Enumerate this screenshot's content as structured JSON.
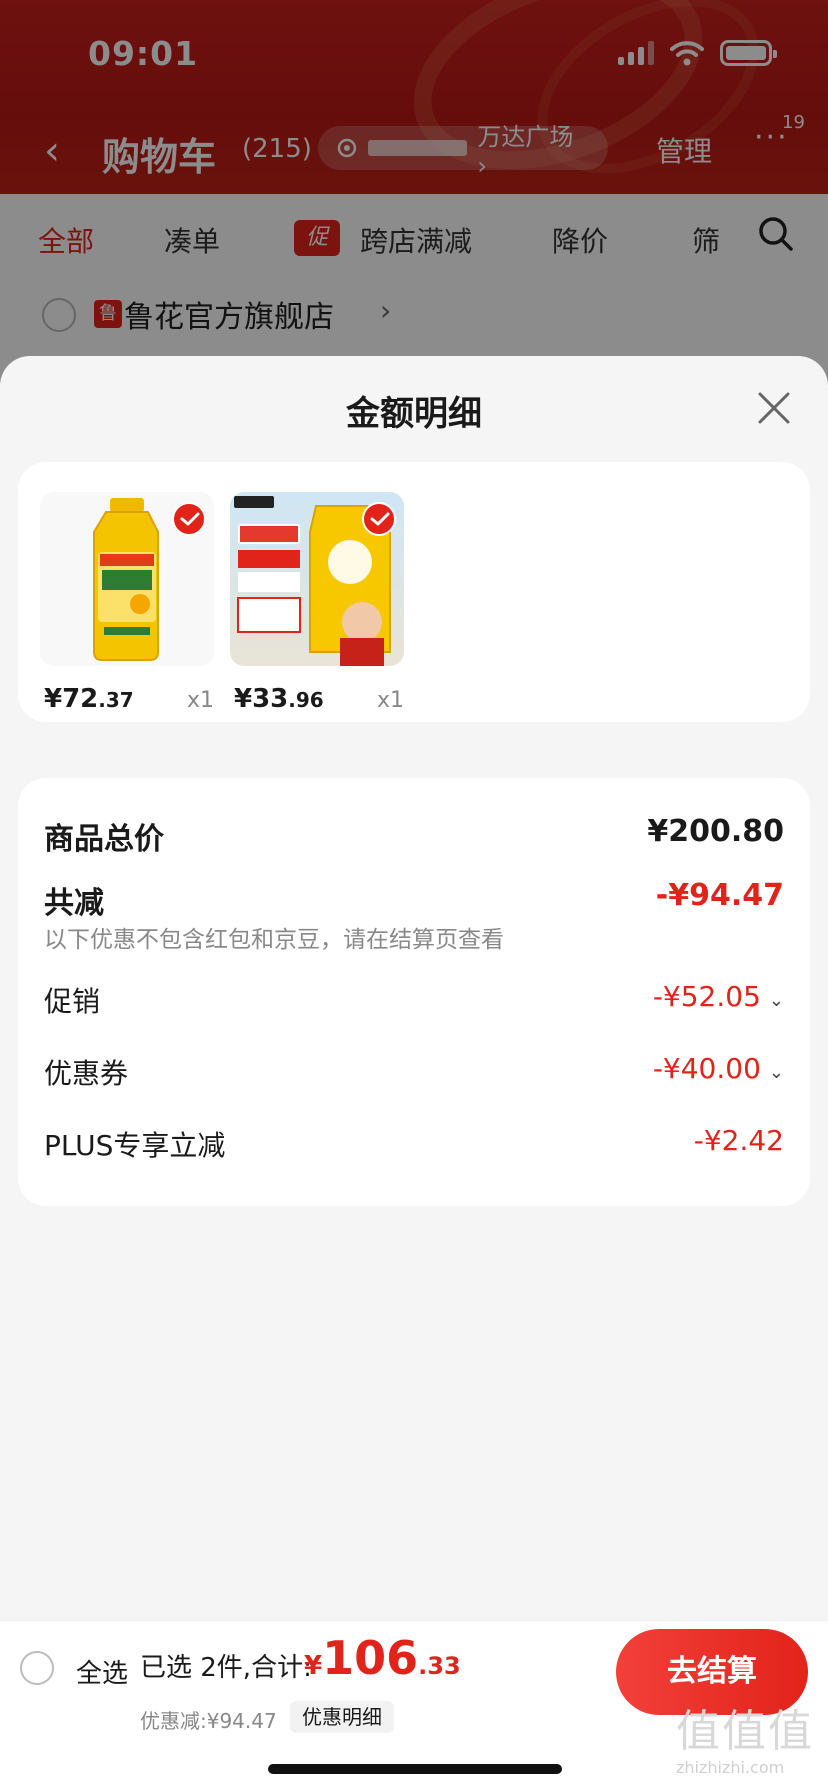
{
  "status_bar": {
    "time": "09:01"
  },
  "nav": {
    "title": "购物车",
    "count": "(215)",
    "location": "万达广场 ›",
    "manage": "管理",
    "more": "···",
    "more_badge": "19"
  },
  "tabs": [
    {
      "label": "全部"
    },
    {
      "label": "凑单"
    },
    {
      "label": "促"
    },
    {
      "label": "跨店满减"
    },
    {
      "label": "降价"
    },
    {
      "label": "筛"
    }
  ],
  "shop": {
    "logo": "鲁",
    "name": "鲁花官方旗舰店",
    "chevron": "›"
  },
  "sheet": {
    "title": "金额明细",
    "products": [
      {
        "price_int": "¥72",
        "price_dec": ".37",
        "qty": "x1",
        "image": "peanut-oil-bottle"
      },
      {
        "price_int": "¥33",
        "price_dec": ".96",
        "qty": "x1",
        "image": "rice-bag"
      }
    ],
    "summary": {
      "total_label": "商品总价",
      "total_value": "¥200.80",
      "discount_label": "共减",
      "discount_value": "-¥94.47",
      "note": "以下优惠不包含红包和京豆，请在结算页查看",
      "items": [
        {
          "label": "促销",
          "value": "-¥52.05",
          "expand": "⌄"
        },
        {
          "label": "优惠券",
          "value": "-¥40.00",
          "expand": "⌄"
        },
        {
          "label": "PLUS专享立减",
          "value": "-¥2.42",
          "expand": ""
        }
      ]
    }
  },
  "bottom_bar": {
    "select_all": "全选",
    "picked": "已选 2件,合计:",
    "total_yen": "¥",
    "total_int": "106",
    "total_dec": ".33",
    "saved": "优惠减:¥94.47",
    "detail": "优惠明细",
    "checkout": "去结算"
  },
  "watermark": {
    "glyph": "值值值",
    "url": "zhizhizhi.com"
  },
  "colors": {
    "accent": "#e2231a",
    "header": "#c8201c"
  }
}
